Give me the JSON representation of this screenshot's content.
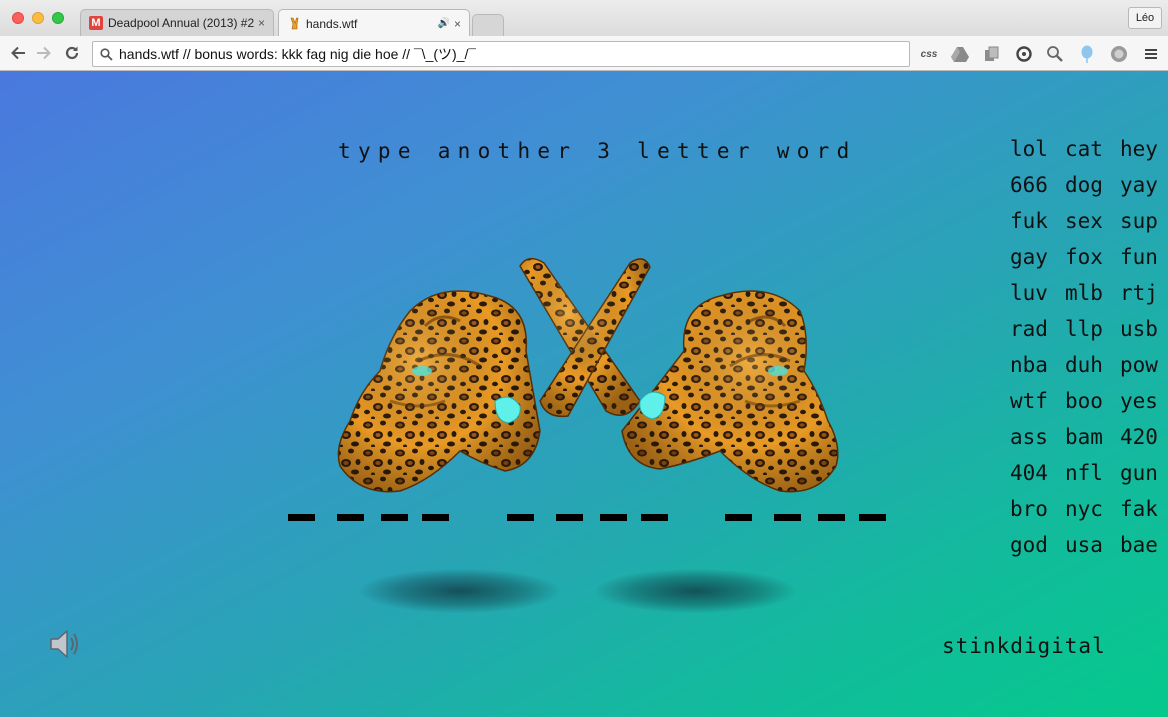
{
  "browser": {
    "tabs": [
      {
        "title": "Deadpool Annual (2013) #2",
        "icon": "gmail-m-icon",
        "active": false
      },
      {
        "title": "hands.wtf",
        "icon": "victory-hand-icon",
        "active": true,
        "audio": true
      }
    ],
    "user": "Léo",
    "url": "hands.wtf // bonus words: kkk fag nig die hoe // ¯\\_(ツ)_/¯",
    "extensions": [
      "css",
      "drive-icon",
      "copy-icon",
      "sync-icon",
      "zoom-icon",
      "balloon-icon",
      "circle-icon",
      "menu-icon"
    ],
    "favicon_glyph": "M",
    "close_glyph": "×",
    "audio_glyph": "🔊"
  },
  "page": {
    "prompt": "type another 3 letter word",
    "words": [
      [
        "lol",
        "cat",
        "hey"
      ],
      [
        "666",
        "dog",
        "yay"
      ],
      [
        "fuk",
        "sex",
        "sup"
      ],
      [
        "gay",
        "fox",
        "fun"
      ],
      [
        "luv",
        "mlb",
        "rtj"
      ],
      [
        "rad",
        "llp",
        "usb"
      ],
      [
        "nba",
        "duh",
        "pow"
      ],
      [
        "wtf",
        "boo",
        "yes"
      ],
      [
        "ass",
        "bam",
        "420"
      ],
      [
        "404",
        "nfl",
        "gun"
      ],
      [
        "bro",
        "nyc",
        "fak"
      ],
      [
        "god",
        "usa",
        "bae"
      ]
    ],
    "slot_groups": 3,
    "dashes_per_group": 4,
    "brand": "stinkdigital",
    "sound_icon": "speaker-icon",
    "colors": {
      "gradient_start": "#4a78de",
      "gradient_end": "#05c98c",
      "nail": "#5ff0ea",
      "leopard": "#e89a22"
    }
  }
}
